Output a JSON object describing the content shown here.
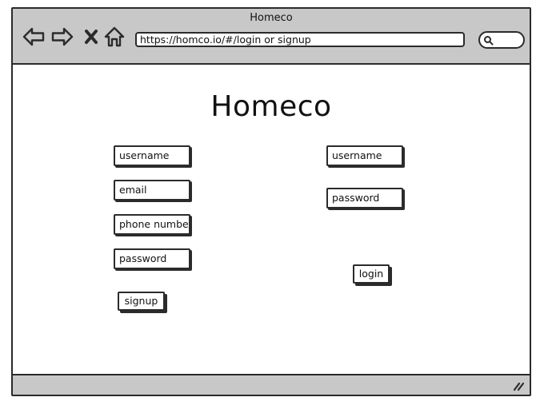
{
  "window": {
    "title": "Homeco"
  },
  "toolbar": {
    "address": "https://homco.io/#/login or signup",
    "icons": [
      "back-arrow-icon",
      "forward-arrow-icon",
      "close-icon",
      "home-icon",
      "search-icon"
    ]
  },
  "page": {
    "heading": "Homeco"
  },
  "signup_form": {
    "username": "username",
    "email": "email",
    "phone": "phone number",
    "password": "password",
    "submit_label": "signup"
  },
  "login_form": {
    "username": "username",
    "password": "password",
    "submit_label": "login"
  },
  "colors": {
    "chrome": "#c8c8c8",
    "stroke": "#2b2b2b",
    "background": "#ffffff"
  }
}
